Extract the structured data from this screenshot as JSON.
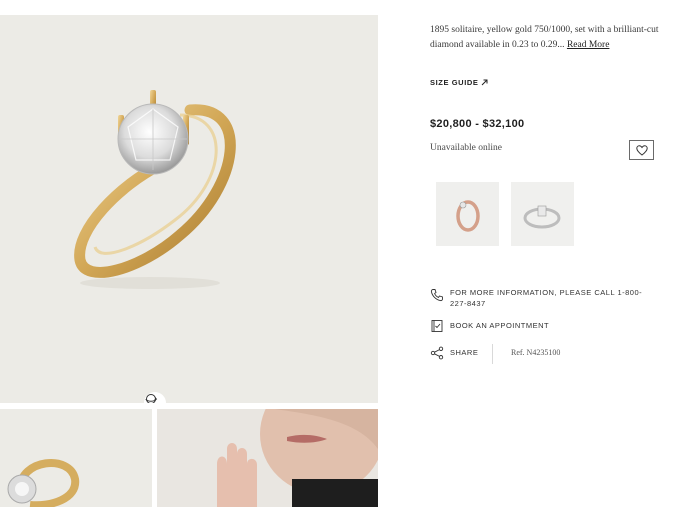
{
  "product": {
    "description": "1895 solitaire, yellow gold 750/1000, set with a brilliant-cut diamond available in 0.23 to 0.29...",
    "read_more_label": "Read More",
    "size_guide_label": "SIZE GUIDE",
    "price": "$20,800 - $32,100",
    "availability": "Unavailable online",
    "reference": "Ref. N4235100"
  },
  "contact": {
    "call_label": "FOR MORE INFORMATION, PLEASE CALL 1-800-227-8437",
    "book_label": "BOOK AN APPOINTMENT",
    "share_label": "SHARE"
  },
  "variants": [
    {
      "metal": "rose gold"
    },
    {
      "metal": "white gold"
    }
  ],
  "icons": {
    "size_guide": "arrow-up-right-icon",
    "wishlist": "heart-icon",
    "call": "phone-icon",
    "book": "calendar-icon",
    "share": "share-icon",
    "rotate": "360-rotate-icon"
  },
  "colors": {
    "gallery_bg": "#ecebe6",
    "gold": "#d9b36a",
    "text": "#2b2b2b"
  }
}
